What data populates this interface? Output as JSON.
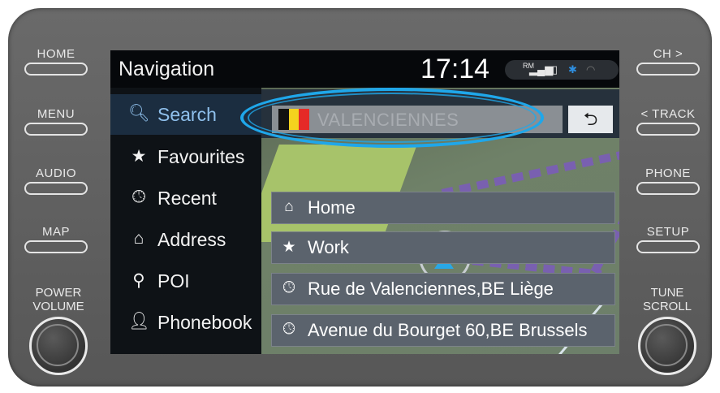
{
  "hardware": {
    "left_buttons": [
      "HOME",
      "MENU",
      "AUDIO",
      "MAP"
    ],
    "right_buttons": [
      "CH >",
      "< TRACK",
      "PHONE",
      "SETUP"
    ],
    "left_knob_label": [
      "POWER",
      "VOLUME"
    ],
    "right_knob_label": [
      "TUNE",
      "SCROLL"
    ]
  },
  "status": {
    "title": "Navigation",
    "clock": "17:14",
    "signal_label": "RM"
  },
  "sidebar": {
    "items": [
      {
        "label": "Search",
        "icon": "search-icon",
        "glyph": "🔍︎"
      },
      {
        "label": "Favourites",
        "icon": "star-icon",
        "glyph": "★"
      },
      {
        "label": "Recent",
        "icon": "clock-icon",
        "glyph": "🕓︎"
      },
      {
        "label": "Address",
        "icon": "address-icon",
        "glyph": "⌂"
      },
      {
        "label": "POI",
        "icon": "pin-icon",
        "glyph": "⚲"
      },
      {
        "label": "Phonebook",
        "icon": "person-icon",
        "glyph": "👤︎"
      }
    ]
  },
  "search": {
    "value": "VALENCIENNES",
    "back_glyph": "⮌",
    "flag_colors": [
      "#111111",
      "#f4d21e",
      "#e52a27"
    ]
  },
  "results": [
    {
      "label": "Home",
      "icon": "home-icon",
      "glyph": "⌂"
    },
    {
      "label": "Work",
      "icon": "star-icon",
      "glyph": "★"
    },
    {
      "label": "Rue de Valenciennes,BE Liège",
      "icon": "clock-icon",
      "glyph": "🕓︎"
    },
    {
      "label": "Avenue du Bourget 60,BE Brussels",
      "icon": "clock-icon",
      "glyph": "🕓︎"
    }
  ],
  "colors": {
    "highlight": "#1fa7ea",
    "active_item": "#8fc0ec"
  }
}
